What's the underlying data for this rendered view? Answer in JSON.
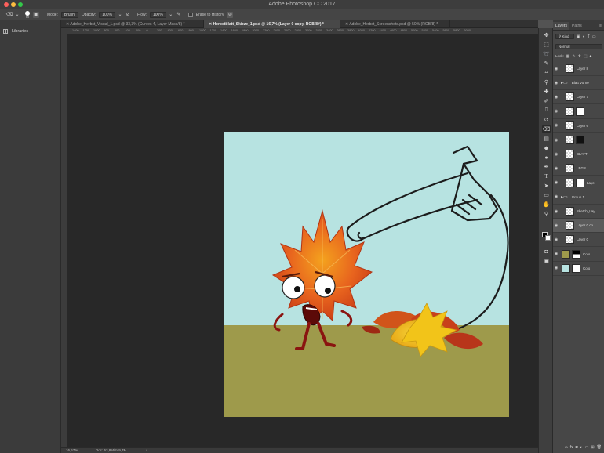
{
  "app": {
    "title": "Adobe Photoshop CC 2017",
    "traffic_colors": [
      "#fc605c",
      "#fdbc40",
      "#34c84a"
    ]
  },
  "options_bar": {
    "brush_size": "65",
    "mode_label": "Mode:",
    "mode_value": "Brush",
    "opacity_label": "Opacity:",
    "opacity_value": "100%",
    "flow_label": "Flow:",
    "flow_value": "100%",
    "erase_history_label": "Erase to History"
  },
  "left_panel": {
    "libraries_label": "Libraries"
  },
  "doc_tabs": [
    {
      "label": "Adobe_Herbst_Visual_1.psd @ 33,3% (Curves 4, Layer Mask/8) *"
    },
    {
      "label": "Herbstblatt_Skizze_1.psd @ 16,7% (Layer 0 copy, RGB/8#) *"
    },
    {
      "label": "Adobe_Herbst_Screenshots.psd @ 50% (RGB/8) *"
    }
  ],
  "ruler": {
    "ticks": [
      "1400",
      "1200",
      "1000",
      "800",
      "600",
      "400",
      "200",
      "0",
      "200",
      "400",
      "600",
      "800",
      "1000",
      "1200",
      "1400",
      "1600",
      "1800",
      "2000",
      "2200",
      "2400",
      "2600",
      "2800",
      "3000",
      "3200",
      "3400",
      "3600",
      "3800",
      "4000",
      "4200",
      "4400",
      "4600",
      "4800",
      "5000",
      "5200",
      "5400",
      "5600",
      "5800",
      "6000"
    ]
  },
  "status_bar": {
    "zoom": "16,67%",
    "doc": "Doc: 53,8M/249,7M"
  },
  "colors": {
    "sky": "#b7e3e1",
    "ground": "#9e9a4b",
    "leaf_orange": "#e8641e",
    "leaf_yellow": "#f2c419"
  },
  "layers_panel": {
    "tabs": [
      "Layers",
      "Paths"
    ],
    "filter_label": "Kind",
    "blend_mode": "Normal",
    "lock_label": "Lock:",
    "layers": [
      {
        "name": "Layer 8",
        "type": "layer"
      },
      {
        "name": "Blatt Vorne",
        "type": "group"
      },
      {
        "name": "Layer 7",
        "type": "layer"
      },
      {
        "name": "",
        "type": "mask"
      },
      {
        "name": "Layer 6",
        "type": "layer"
      },
      {
        "name": "",
        "type": "mask-dark"
      },
      {
        "name": "BLATT",
        "type": "layer"
      },
      {
        "name": "LEGS",
        "type": "layer"
      },
      {
        "name": "Laye",
        "type": "mask"
      },
      {
        "name": "Group 1",
        "type": "group"
      },
      {
        "name": "Sketch_Lay",
        "type": "layer"
      },
      {
        "name": "Layer 0 co",
        "type": "layer",
        "selected": true
      },
      {
        "name": "Layer 0",
        "type": "layer"
      },
      {
        "name": "Colo",
        "type": "fill-olive"
      },
      {
        "name": "Colo",
        "type": "fill-teal"
      }
    ],
    "bottom_icons": [
      "link-icon",
      "fx-icon",
      "mask-icon",
      "adjustment-icon",
      "folder-icon",
      "new-layer-icon",
      "trash-icon"
    ]
  }
}
